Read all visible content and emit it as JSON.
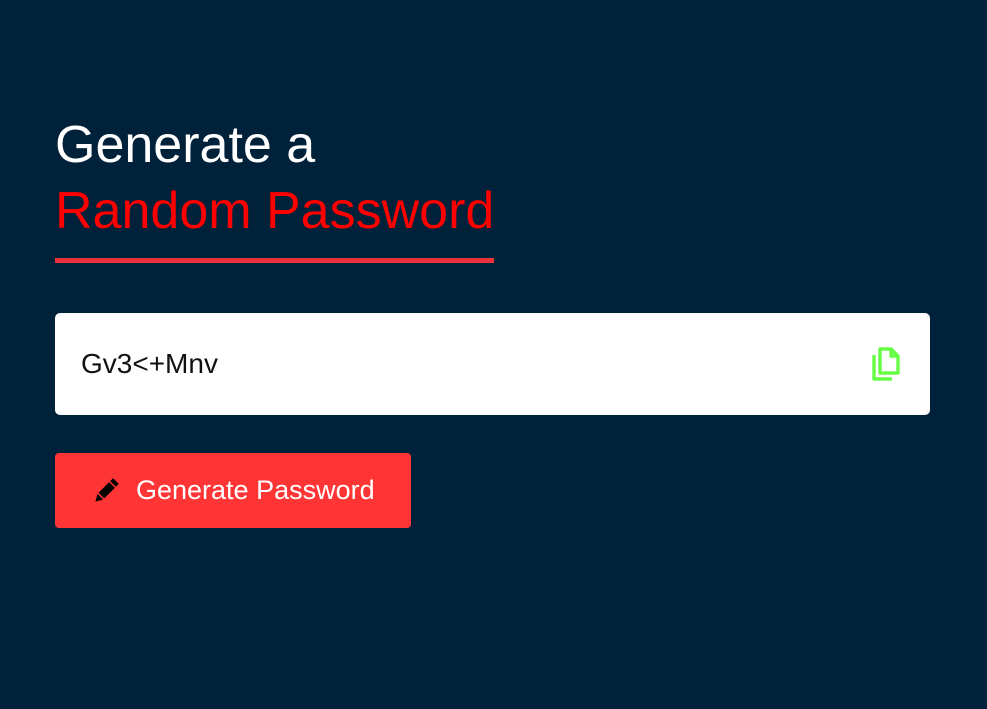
{
  "heading": {
    "line1": "Generate a",
    "line2": "Random Password"
  },
  "password": {
    "value": "Gv3<+Mnv",
    "copy_icon": "copy-icon"
  },
  "generate_button": {
    "label": "Generate Password",
    "icon": "pencil-icon"
  },
  "colors": {
    "background": "#00213a",
    "accent_red": "#ff0000",
    "underline": "#e8333b",
    "button": "#ff3535",
    "copy_icon": "#66ff44"
  }
}
